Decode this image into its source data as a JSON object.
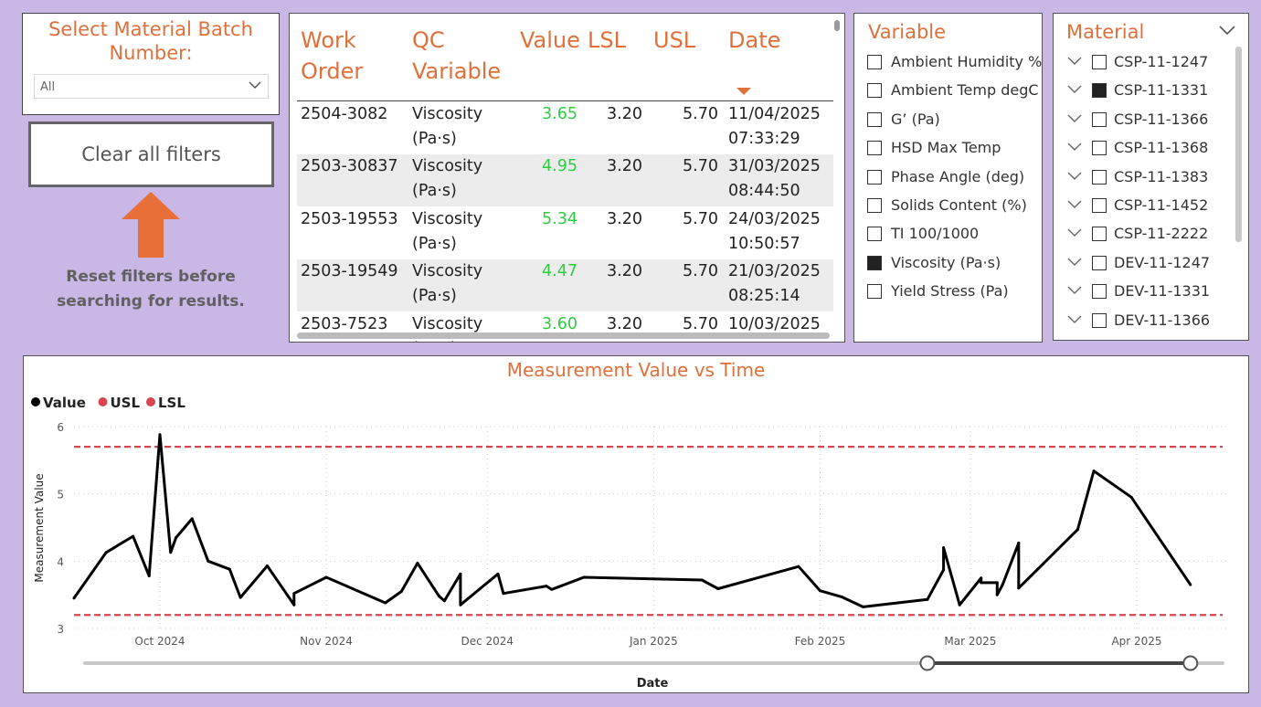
{
  "batch_slicer": {
    "title": "Select Material Batch Number:",
    "selected": "All"
  },
  "clear_button": {
    "label": "Clear all filters"
  },
  "reset_note": "Reset filters before searching for results.",
  "table": {
    "columns": [
      "Work Order",
      "QC Variable",
      "Value",
      "LSL",
      "USL",
      "Date"
    ],
    "rows": [
      {
        "work_order": "2504-3082",
        "variable": "Viscosity",
        "unit": "(Pa·s)",
        "value": "3.65",
        "lsl": "3.20",
        "usl": "5.70",
        "date": "11/04/2025",
        "time": "07:33:29"
      },
      {
        "work_order": "2503-30837",
        "variable": "Viscosity",
        "unit": "(Pa·s)",
        "value": "4.95",
        "lsl": "3.20",
        "usl": "5.70",
        "date": "31/03/2025",
        "time": "08:44:50"
      },
      {
        "work_order": "2503-19553",
        "variable": "Viscosity",
        "unit": "(Pa·s)",
        "value": "5.34",
        "lsl": "3.20",
        "usl": "5.70",
        "date": "24/03/2025",
        "time": "10:50:57"
      },
      {
        "work_order": "2503-19549",
        "variable": "Viscosity",
        "unit": "(Pa·s)",
        "value": "4.47",
        "lsl": "3.20",
        "usl": "5.70",
        "date": "21/03/2025",
        "time": "08:25:14"
      },
      {
        "work_order": "2503-7523",
        "variable": "Viscosity",
        "unit": "(Pa·s)",
        "value": "3.60",
        "lsl": "3.20",
        "usl": "5.70",
        "date": "10/03/2025",
        "time": ""
      }
    ]
  },
  "variable_slicer": {
    "title": "Variable",
    "items": [
      {
        "label": "Ambient Humidity %",
        "checked": false
      },
      {
        "label": "Ambient Temp degC",
        "checked": false
      },
      {
        "label": "G’ (Pa)",
        "checked": false
      },
      {
        "label": "HSD Max Temp",
        "checked": false
      },
      {
        "label": "Phase Angle (deg)",
        "checked": false
      },
      {
        "label": "Solids Content (%)",
        "checked": false
      },
      {
        "label": "TI 100/1000",
        "checked": false
      },
      {
        "label": "Viscosity (Pa·s)",
        "checked": true
      },
      {
        "label": "Yield Stress (Pa)",
        "checked": false
      }
    ]
  },
  "material_slicer": {
    "title": "Material",
    "items": [
      {
        "label": "CSP-11-1247",
        "checked": false
      },
      {
        "label": "CSP-11-1331",
        "checked": true
      },
      {
        "label": "CSP-11-1366",
        "checked": false
      },
      {
        "label": "CSP-11-1368",
        "checked": false
      },
      {
        "label": "CSP-11-1383",
        "checked": false
      },
      {
        "label": "CSP-11-1452",
        "checked": false
      },
      {
        "label": "CSP-11-2222",
        "checked": false
      },
      {
        "label": "DEV-11-1247",
        "checked": false
      },
      {
        "label": "DEV-11-1331",
        "checked": false
      },
      {
        "label": "DEV-11-1366",
        "checked": false
      }
    ]
  },
  "chart_data": {
    "type": "line",
    "title": "Measurement Value vs Time",
    "xlabel": "Date",
    "ylabel": "Measurement Value",
    "ylim": [
      3,
      6
    ],
    "xlim": [
      "2024-09-15",
      "2025-04-17"
    ],
    "y_ticks": [
      3,
      4,
      5,
      6
    ],
    "x_ticks": [
      {
        "date": "2024-10-01",
        "label": "Oct 2024"
      },
      {
        "date": "2024-11-01",
        "label": "Nov 2024"
      },
      {
        "date": "2024-12-01",
        "label": "Dec 2024"
      },
      {
        "date": "2025-01-01",
        "label": "Jan 2025"
      },
      {
        "date": "2025-02-01",
        "label": "Feb 2025"
      },
      {
        "date": "2025-03-01",
        "label": "Mar 2025"
      },
      {
        "date": "2025-04-01",
        "label": "Apr 2025"
      }
    ],
    "legend": {
      "placement": "top-left",
      "entries": [
        {
          "name": "Value",
          "color": "#000000"
        },
        {
          "name": "USL",
          "color": "#d64550"
        },
        {
          "name": "LSL",
          "color": "#d64550"
        }
      ]
    },
    "grid": true,
    "usl": 5.7,
    "lsl": 3.2,
    "series": [
      {
        "name": "Value",
        "color": "#000000",
        "points": [
          [
            "2024-09-15",
            3.45
          ],
          [
            "2024-09-21",
            4.13
          ],
          [
            "2024-09-26",
            4.37
          ],
          [
            "2024-09-29",
            3.78
          ],
          [
            "2024-10-01",
            5.88
          ],
          [
            "2024-10-03",
            4.13
          ],
          [
            "2024-10-04",
            4.35
          ],
          [
            "2024-10-07",
            4.63
          ],
          [
            "2024-10-10",
            4.0
          ],
          [
            "2024-10-14",
            3.88
          ],
          [
            "2024-10-16",
            3.46
          ],
          [
            "2024-10-21",
            3.93
          ],
          [
            "2024-10-26",
            3.35
          ],
          [
            "2024-10-26",
            3.52
          ],
          [
            "2024-11-01",
            3.76
          ],
          [
            "2024-11-12",
            3.38
          ],
          [
            "2024-11-15",
            3.55
          ],
          [
            "2024-11-18",
            3.97
          ],
          [
            "2024-11-22",
            3.48
          ],
          [
            "2024-11-23",
            3.41
          ],
          [
            "2024-11-26",
            3.81
          ],
          [
            "2024-11-26",
            3.35
          ],
          [
            "2024-12-03",
            3.81
          ],
          [
            "2024-12-04",
            3.52
          ],
          [
            "2024-12-12",
            3.63
          ],
          [
            "2024-12-13",
            3.58
          ],
          [
            "2024-12-19",
            3.76
          ],
          [
            "2025-01-10",
            3.72
          ],
          [
            "2025-01-13",
            3.59
          ],
          [
            "2025-01-28",
            3.92
          ],
          [
            "2025-02-01",
            3.56
          ],
          [
            "2025-02-05",
            3.47
          ],
          [
            "2025-02-09",
            3.32
          ],
          [
            "2025-02-21",
            3.43
          ],
          [
            "2025-02-24",
            3.87
          ],
          [
            "2025-02-24",
            4.2
          ],
          [
            "2025-02-27",
            3.35
          ],
          [
            "2025-03-03",
            3.75
          ],
          [
            "2025-03-03",
            3.68
          ],
          [
            "2025-03-06",
            3.68
          ],
          [
            "2025-03-06",
            3.5
          ],
          [
            "2025-03-07",
            3.65
          ],
          [
            "2025-03-10",
            4.27
          ],
          [
            "2025-03-10",
            3.6
          ],
          [
            "2025-03-21",
            4.47
          ],
          [
            "2025-03-24",
            5.34
          ],
          [
            "2025-03-31",
            4.95
          ],
          [
            "2025-04-11",
            3.65
          ]
        ]
      }
    ],
    "range_slider": {
      "start": "2025-02-21",
      "end": "2025-04-11"
    }
  }
}
